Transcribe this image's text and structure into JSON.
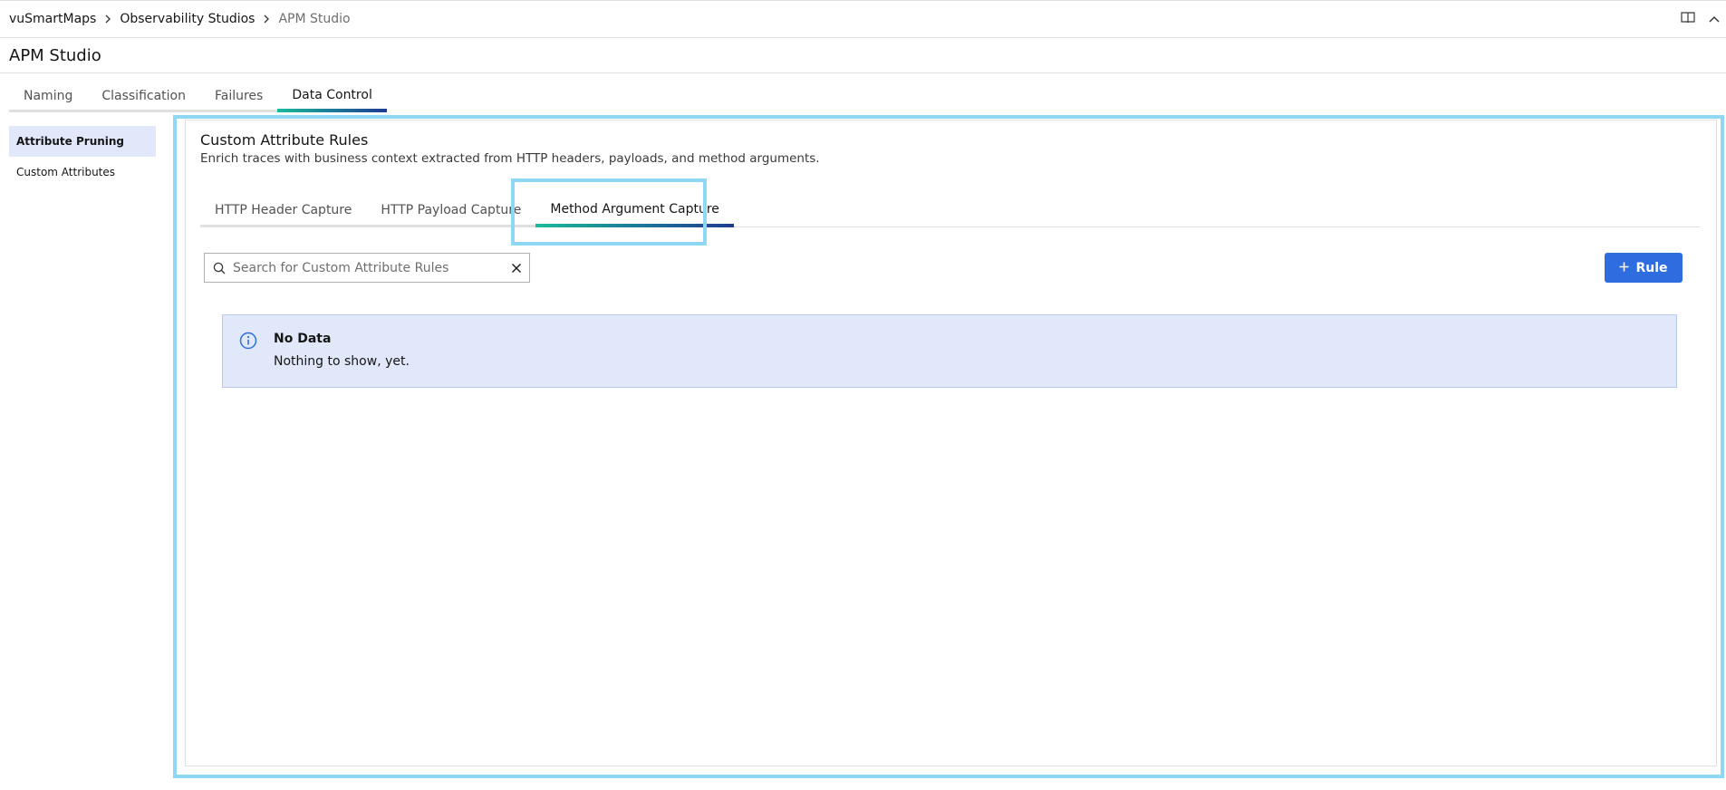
{
  "breadcrumb": {
    "items": [
      "vuSmartMaps",
      "Observability Studios",
      "APM Studio"
    ]
  },
  "page": {
    "title": "APM Studio"
  },
  "tabs": [
    "Naming",
    "Classification",
    "Failures",
    "Data Control"
  ],
  "active_tab": "Data Control",
  "sidebar": {
    "items": [
      {
        "label": "Attribute Pruning",
        "active": true
      },
      {
        "label": "Custom Attributes",
        "active": false
      }
    ]
  },
  "panel": {
    "title": "Custom Attribute Rules",
    "subtitle": "Enrich traces with business context extracted from HTTP headers, payloads, and method arguments.",
    "subtabs": [
      "HTTP Header Capture",
      "HTTP Payload Capture",
      "Method Argument Capture"
    ],
    "active_subtab": "Method Argument Capture",
    "search_placeholder": "Search for Custom Attribute Rules",
    "search_value": "",
    "add_button_label": "Rule",
    "empty": {
      "title": "No Data",
      "message": "Nothing to show, yet."
    }
  },
  "colors": {
    "accent": "#2d6de0",
    "tab_gradient_start": "#1abc9c",
    "tab_gradient_end": "#1f3a93",
    "highlight": "#8ed7f5",
    "notice_bg": "#e0e8f9"
  }
}
